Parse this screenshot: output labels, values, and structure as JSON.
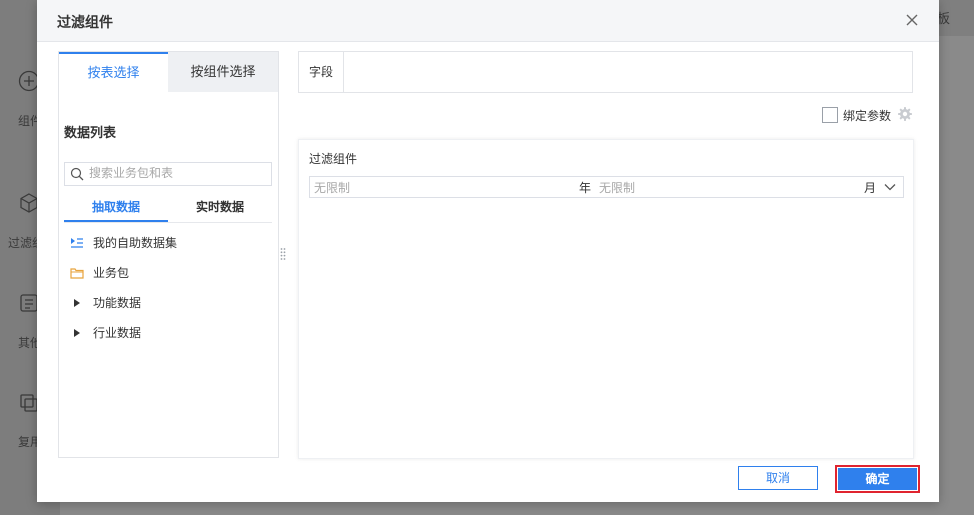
{
  "background": {
    "top_right_text": "板",
    "sidebar": [
      {
        "label": "组件",
        "icon": "plus-circle-icon"
      },
      {
        "label": "过滤组",
        "icon": "cube-icon"
      },
      {
        "label": "其他",
        "icon": "document-icon"
      },
      {
        "label": "复用",
        "icon": "copy-icon"
      }
    ]
  },
  "dialog": {
    "title": "过滤组件",
    "close_icon": "close-icon"
  },
  "left_panel": {
    "tabs": [
      {
        "label": "按表选择",
        "active": true
      },
      {
        "label": "按组件选择",
        "active": false
      }
    ],
    "list_title": "数据列表",
    "search": {
      "placeholder": "搜索业务包和表",
      "value": ""
    },
    "subtabs": [
      {
        "label": "抽取数据",
        "active": true
      },
      {
        "label": "实时数据",
        "active": false
      }
    ],
    "tree": [
      {
        "label": "我的自助数据集",
        "icon": "self-service-dataset-icon"
      },
      {
        "label": "业务包",
        "icon": "folder-icon"
      },
      {
        "label": "功能数据",
        "icon": "caret-right-icon"
      },
      {
        "label": "行业数据",
        "icon": "caret-right-icon"
      }
    ]
  },
  "right_panel": {
    "field_label": "字段",
    "bind_param_label": "绑定参数",
    "bind_param_checked": false,
    "preview": {
      "title": "过滤组件",
      "year_placeholder": "无限制",
      "year_unit": "年",
      "month_placeholder": "无限制",
      "month_unit": "月"
    }
  },
  "buttons": {
    "cancel": "取消",
    "ok": "确定"
  },
  "colors": {
    "accent": "#2f80ed",
    "highlight_border": "#e0242f"
  }
}
